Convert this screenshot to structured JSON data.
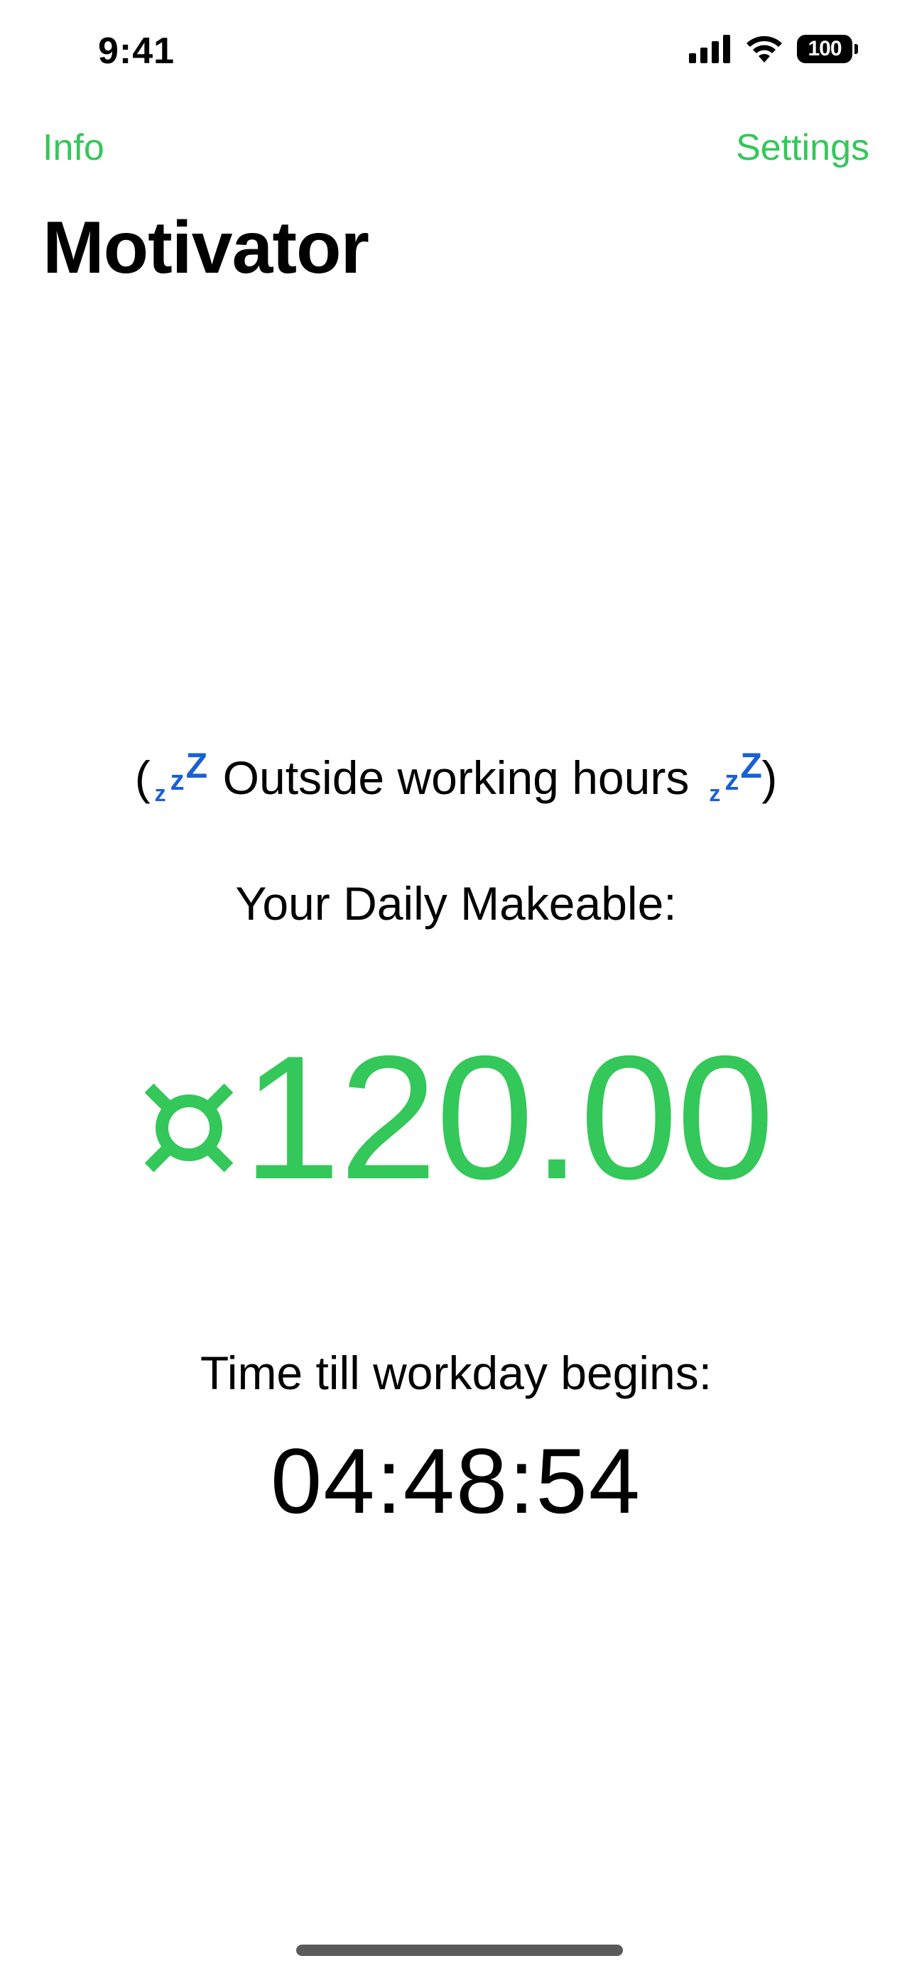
{
  "status_bar": {
    "time": "9:41",
    "battery_level": "100",
    "icons": [
      "cellular-signal-icon",
      "wifi-icon",
      "battery-icon"
    ]
  },
  "nav": {
    "left_label": "Info",
    "right_label": "Settings",
    "title": "Motivator"
  },
  "main": {
    "status_open": "(",
    "status_text": "Outside working hours",
    "status_close": ")",
    "status_icon": "zzz-sleep-icon",
    "daily_label": "Your Daily Makeable:",
    "currency_icon": "generic-currency-sign-icon",
    "amount": "120.00",
    "countdown_label": "Time till workday begins:",
    "countdown_value": "04:48:54"
  },
  "colors": {
    "accent": "#34c759",
    "zzz": "#1b5fd6",
    "text": "#000000",
    "background": "#ffffff"
  }
}
